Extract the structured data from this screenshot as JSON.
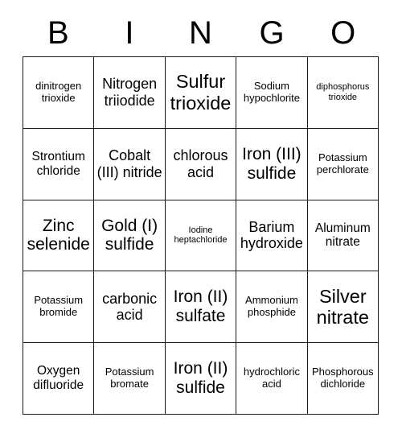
{
  "card": {
    "header_letters": [
      "B",
      "I",
      "N",
      "G",
      "O"
    ],
    "rows": [
      [
        {
          "text": "dinitrogen trioxide",
          "size": "sm"
        },
        {
          "text": "Nitrogen triiodide",
          "size": "lg"
        },
        {
          "text": "Sulfur trioxide",
          "size": "xxl"
        },
        {
          "text": "Sodium hypochlorite",
          "size": "sm"
        },
        {
          "text": "diphosphorus trioxide",
          "size": "xs"
        }
      ],
      [
        {
          "text": "Strontium chloride",
          "size": "md"
        },
        {
          "text": "Cobalt (III) nitride",
          "size": "lg"
        },
        {
          "text": "chlorous acid",
          "size": "lg"
        },
        {
          "text": "Iron (III) sulfide",
          "size": "xl"
        },
        {
          "text": "Potassium perchlorate",
          "size": "sm"
        }
      ],
      [
        {
          "text": "Zinc selenide",
          "size": "xl"
        },
        {
          "text": "Gold (I) sulfide",
          "size": "xl"
        },
        {
          "text": "Iodine heptachloride",
          "size": "xs"
        },
        {
          "text": "Barium hydroxide",
          "size": "lg"
        },
        {
          "text": "Aluminum nitrate",
          "size": "md"
        }
      ],
      [
        {
          "text": "Potassium bromide",
          "size": "sm"
        },
        {
          "text": "carbonic acid",
          "size": "lg"
        },
        {
          "text": "Iron (II) sulfate",
          "size": "xl"
        },
        {
          "text": "Ammonium phosphide",
          "size": "sm"
        },
        {
          "text": "Silver nitrate",
          "size": "xxl"
        }
      ],
      [
        {
          "text": "Oxygen difluoride",
          "size": "md"
        },
        {
          "text": "Potassium bromate",
          "size": "sm"
        },
        {
          "text": "Iron (II) sulfide",
          "size": "xl"
        },
        {
          "text": "hydrochloric acid",
          "size": "sm"
        },
        {
          "text": "Phosphorous dichloride",
          "size": "sm"
        }
      ]
    ]
  },
  "colors": {
    "text": "#000000",
    "border": "#1a1a1a",
    "background": "#ffffff"
  }
}
